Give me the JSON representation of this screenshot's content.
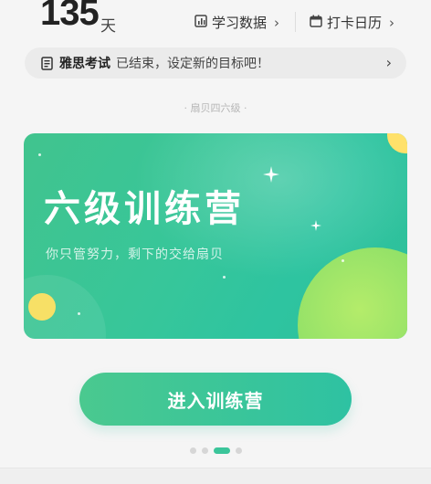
{
  "stats": {
    "days_value": "135",
    "days_unit": "天",
    "study_data_label": "学习数据",
    "checkin_calendar_label": "打卡日历",
    "chevron": "›"
  },
  "notice": {
    "exam_name": "雅思考试",
    "message": "已结束，设定新的目标吧！",
    "arrow": "›"
  },
  "section_caption": "· 扇贝四六级 ·",
  "banner": {
    "title": "六级训练营",
    "subtitle": "你只管努力，剩下的交给扇贝"
  },
  "enter_button_label": "进入训练营",
  "pager": {
    "count": 4,
    "active_index": 2
  },
  "colors": {
    "accent_green": "#3bc59a",
    "banner_start": "#41c48e",
    "banner_end": "#2ec4a0"
  }
}
